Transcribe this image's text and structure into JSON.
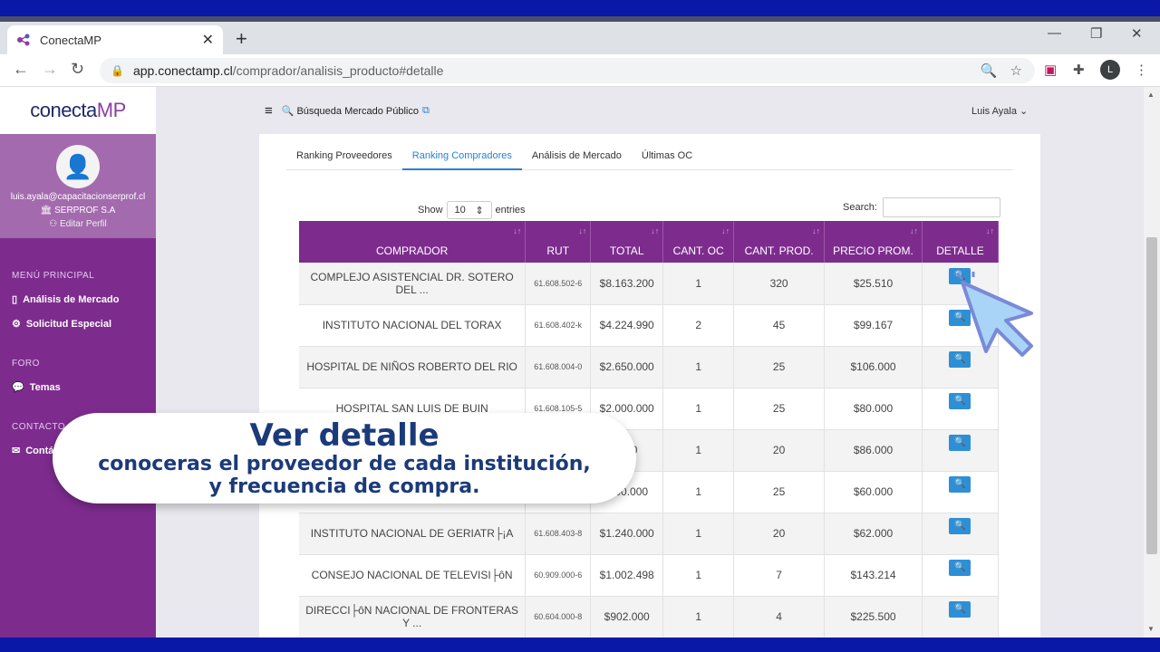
{
  "browser": {
    "tab_title": "ConectaMP",
    "url_host": "app.conectamp.cl",
    "url_path": "/comprador/analisis_producto#detalle",
    "profile_initial": "L"
  },
  "sidebar": {
    "logo_a": "conecta",
    "logo_b": "MP",
    "email": "luis.ayala@capacitacionserprof.cl",
    "company": "SERPROF S.A",
    "edit_profile": "Editar Perfil",
    "sections": [
      {
        "title": "MENÚ PRINCIPAL",
        "items": [
          "Análisis de Mercado",
          "Solicitud Especial"
        ]
      },
      {
        "title": "FORO",
        "items": [
          "Temas"
        ]
      },
      {
        "title": "CONTACTO",
        "items": [
          "Contá"
        ]
      }
    ]
  },
  "header": {
    "search_label": "Búsqueda Mercado Público",
    "user_name": "Luis Ayala"
  },
  "tabs": [
    "Ranking Proveedores",
    "Ranking Compradores",
    "Análisis de Mercado",
    "Últimas OC"
  ],
  "table_controls": {
    "show_label": "Show",
    "entries_value": "10",
    "entries_label": "entries",
    "search_label": "Search:"
  },
  "columns": [
    "COMPRADOR",
    "RUT",
    "TOTAL",
    "CANT. OC",
    "CANT. PROD.",
    "PRECIO PROM.",
    "DETALLE"
  ],
  "rows": [
    {
      "comprador": "COMPLEJO ASISTENCIAL DR. SOTERO DEL ...",
      "rut": "61.608.502-6",
      "total": "$8.163.200",
      "oc": "1",
      "prod": "320",
      "precio": "$25.510"
    },
    {
      "comprador": "INSTITUTO NACIONAL DEL TORAX",
      "rut": "61.608.402-k",
      "total": "$4.224.990",
      "oc": "2",
      "prod": "45",
      "precio": "$99.167"
    },
    {
      "comprador": "HOSPITAL DE NIÑOS ROBERTO DEL RIO",
      "rut": "61.608.004-0",
      "total": "$2.650.000",
      "oc": "1",
      "prod": "25",
      "precio": "$106.000"
    },
    {
      "comprador": "HOSPITAL SAN LUIS DE BUIN",
      "rut": "61.608.105-5",
      "total": "$2.000.000",
      "oc": "1",
      "prod": "25",
      "precio": "$80.000"
    },
    {
      "comprador": "",
      "rut": "",
      "total": ".000",
      "oc": "1",
      "prod": "20",
      "precio": "$86.000"
    },
    {
      "comprador": "",
      "rut": "",
      "total": ".500.000",
      "oc": "1",
      "prod": "25",
      "precio": "$60.000"
    },
    {
      "comprador": "INSTITUTO NACIONAL DE GERIATR├¡A",
      "rut": "61.608.403-8",
      "total": "$1.240.000",
      "oc": "1",
      "prod": "20",
      "precio": "$62.000"
    },
    {
      "comprador": "CONSEJO NACIONAL DE TELEVISI├ôN",
      "rut": "60.909.000-6",
      "total": "$1.002.498",
      "oc": "1",
      "prod": "7",
      "precio": "$143.214"
    },
    {
      "comprador": "DIRECCI├ôN NACIONAL DE FRONTERAS Y ...",
      "rut": "60.604.000-8",
      "total": "$902.000",
      "oc": "1",
      "prod": "4",
      "precio": "$225.500"
    }
  ],
  "callout": {
    "title": "Ver detalle",
    "line1": "conoceras el proveedor de cada institución,",
    "line2": "y frecuencia de compra."
  },
  "colors": {
    "sidebar": "#7d2c8e",
    "accent_blue": "#2a7fd4",
    "callout_text": "#1b3a7a"
  }
}
